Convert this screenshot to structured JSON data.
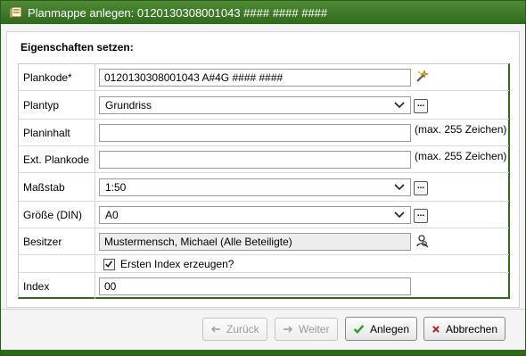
{
  "window": {
    "title": "Planmappe anlegen: 0120130308001043 #### #### ####",
    "section_heading": "Eigenschaften setzen:"
  },
  "form": {
    "plancode": {
      "label": "Plankode*",
      "value": "0120130308001043 A#4G #### ####"
    },
    "plantype": {
      "label": "Plantyp",
      "value": "Grundriss"
    },
    "content": {
      "label": "Planinhalt",
      "value": "",
      "hint": "(max. 255 Zeichen)"
    },
    "ext_code": {
      "label": "Ext. Plankode",
      "value": "",
      "hint": "(max. 255 Zeichen)"
    },
    "scale": {
      "label": "Maßstab",
      "value": "1:50"
    },
    "size": {
      "label": "Größe (DIN)",
      "value": "A0"
    },
    "owner": {
      "label": "Besitzer",
      "value": "Mustermensch, Michael (Alle Beteiligte)"
    },
    "first_index": {
      "label": "Ersten Index erzeugen?",
      "checked": true
    },
    "index": {
      "label": "Index",
      "value": "00"
    },
    "dots_label": "..."
  },
  "buttons": {
    "back": {
      "label": "Zurück",
      "enabled": false
    },
    "next": {
      "label": "Weiter",
      "enabled": false
    },
    "create": {
      "label": "Anlegen",
      "enabled": true
    },
    "cancel": {
      "label": "Abbrechen",
      "enabled": true
    }
  },
  "colors": {
    "accent": "#2f6a1c",
    "ok": "#2e9a2e",
    "cancel": "#b01818"
  },
  "icons": [
    "notebook-icon",
    "wand-icon",
    "ellipsis-button-icon",
    "person-lookup-icon",
    "chevron-down-icon",
    "checkmark-icon",
    "arrow-left-icon",
    "arrow-right-icon",
    "close-x-icon"
  ]
}
